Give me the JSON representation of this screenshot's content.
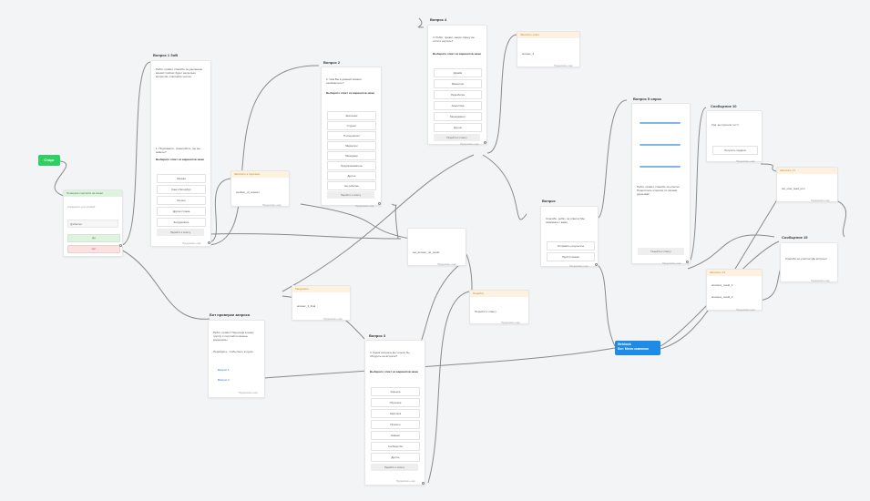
{
  "colors": {
    "accent_green": "#2fcf66",
    "accent_blue": "#1e8ce6",
    "tag_orange": "#fdf1e0",
    "tag_green": "#dff2e0"
  },
  "start_label": "Старт",
  "node_a": {
    "tag": "Проверка подписки на канал",
    "field_label": "Определить для условий",
    "field_value": "@channel",
    "yes": "Да",
    "no": "Нет"
  },
  "node_b": {
    "title": "Вопрос 1 ЗоВ",
    "text": "Ребят, привет, спасибо за уделенное время! Сейчас будет несколько вопросов, отвечайте честно.",
    "question": "1. Подскажите, пожалуйста, где вы живете?",
    "prompt": "Выберите ответ из вариантов ниже",
    "options": [
      "Москва",
      "Санкт-Петербург",
      "Регион",
      "Другая страна",
      "Затрудняюсь"
    ],
    "next": "Перейти к ответу",
    "foot": "Продолжить ещё"
  },
  "node_c": {
    "tag": "Записать в перемен.",
    "value": "position_of_answer",
    "foot": "Продолжить ещё"
  },
  "node_d": {
    "title": "Вопрос 2",
    "question": "2. Чем Вы в данный момент занимаетесь?",
    "prompt": "Выберите ответ из вариантов ниже",
    "options": [
      "Школьник",
      "Студент",
      "IT-специалист",
      "Маркетинг",
      "Менеджер",
      "Предприниматель",
      "Другое",
      "Не работаю"
    ],
    "next": "Перейти к ответу",
    "foot": "Продолжить ещё"
  },
  "node_e": {
    "title": "Вопрос 4",
    "question": "4. Ребят, привет, какую сферу вы хотите изучать?",
    "prompt": "Выберите ответ из вариантов ниже",
    "options": [
      "Дизайн",
      "Маркетинг",
      "Разработка",
      "Аналитика",
      "Менеджмент",
      "Другое"
    ],
    "next": "Перейти к ответу",
    "foot": "Продолжить ещё"
  },
  "node_f": {
    "tag": "Записать ответ",
    "value": "answer_4",
    "foot": "Продолжить ещё"
  },
  "node_g": {
    "title": "",
    "value": "set_answer_ok_result",
    "foot": "Продолжить ещё"
  },
  "node_h": {
    "tag": "Уведомить",
    "value": "answer_3_final",
    "foot": "Продолжить ещё"
  },
  "node_i": {
    "tag": "Перейти",
    "value": "Перейти к ответу",
    "foot": "Продолжить ещё"
  },
  "node_j": {
    "title": "Бот проверки запроса",
    "text1": "Ребят, привет! Переходи в нашу группу и получай полезные материалы",
    "text2": "Перейдите, чтобы быть в курсе",
    "opt1": "Вопрос 1",
    "opt2": "Вопрос 2",
    "foot": "Продолжить ещё"
  },
  "node_k": {
    "title": "Вопрос 3",
    "question": "3. Какие вопросы вы хотели бы обсудить на встрече?",
    "prompt": "Выберите ответ из вариантов ниже",
    "options": [
      "Карьера",
      "Обучение",
      "Зарплата",
      "Проекты",
      "Навыки",
      "Сообщество",
      "Другое"
    ],
    "next": "Перейти к ответу",
    "foot": "Продолжить ещё"
  },
  "node_l": {
    "title": "Вопрос",
    "text": "Спасибо, ребят, за ответы! Мы свяжемся с вами.",
    "opt1": "Отправить результаты",
    "opt2": "Пройти заново",
    "foot": "Продолжить ещё"
  },
  "node_m": {
    "title": "Вопрос 5 опрос",
    "text": "Ребят, привет, спасибо за ответы! Поделитесь опросом со своими друзьями!",
    "next": "Перейти к ответу",
    "foot": "Продолжить ещё"
  },
  "node_n": {
    "title": "Сообщение 10",
    "text": "Ура, вы прошли тест!",
    "button": "Получить подарок",
    "foot": "Продолжить ещё"
  },
  "node_o": {
    "tag": "Записать 17",
    "value": "set_user_lead_utm",
    "foot": "Продолжить ещё"
  },
  "node_p": {
    "tag": "Записать 13",
    "value1": "answers_result_1",
    "value2": "answers_result_2",
    "foot": "Продолжить ещё"
  },
  "node_q": {
    "title": "Сообщение 15",
    "text": "Спасибо за участие! До встречи!",
    "foot": "Продолжить ещё"
  },
  "target": {
    "line1": "Webhook",
    "line2": "Бот: Меню кампании"
  }
}
